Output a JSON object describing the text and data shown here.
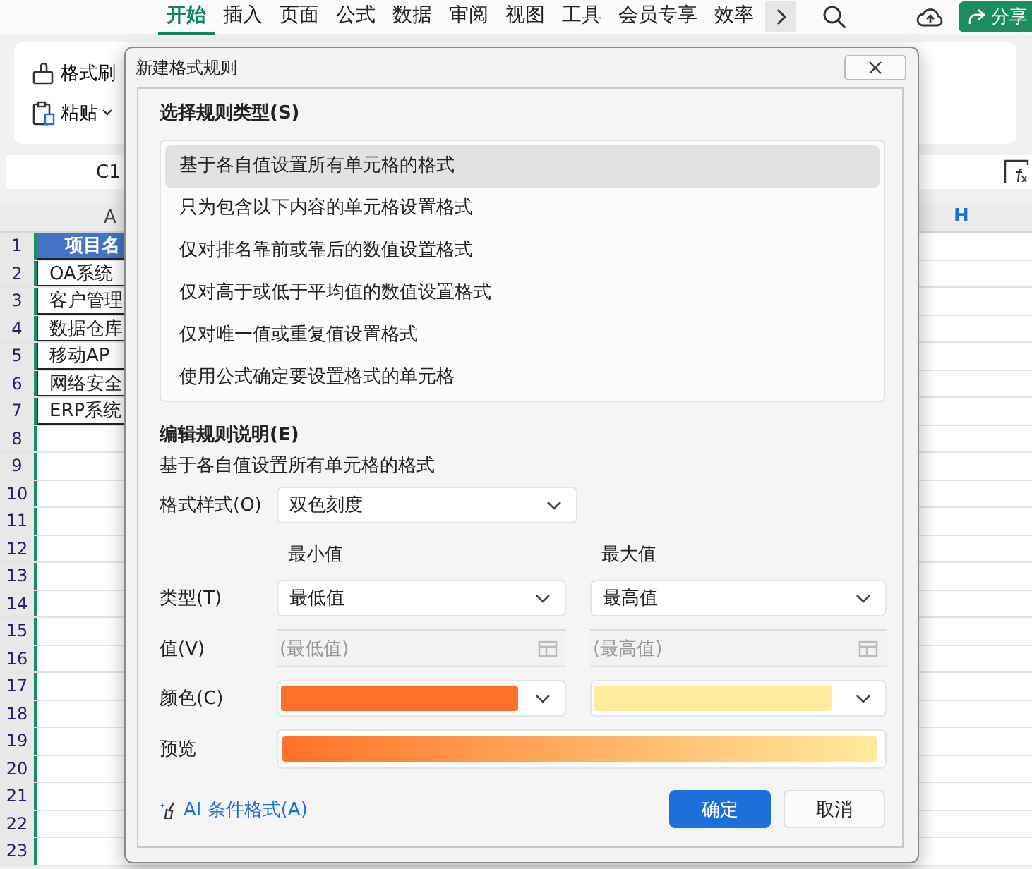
{
  "menu_tabs": [
    {
      "label": "开始",
      "selected": true
    },
    {
      "label": "插入",
      "selected": false
    },
    {
      "label": "页面",
      "selected": false
    },
    {
      "label": "公式",
      "selected": false
    },
    {
      "label": "数据",
      "selected": false
    },
    {
      "label": "审阅",
      "selected": false
    },
    {
      "label": "视图",
      "selected": false
    },
    {
      "label": "工具",
      "selected": false
    },
    {
      "label": "会员专享",
      "selected": false
    },
    {
      "label": "效率",
      "selected": false
    }
  ],
  "share_button": "分享",
  "ribbon": {
    "format_painter": "格式刷",
    "paste": "粘贴"
  },
  "name_box": "C1",
  "columns": [
    "A",
    "H"
  ],
  "rows": [
    {
      "number": "1",
      "kind": "header",
      "a": "项目名"
    },
    {
      "number": "2",
      "kind": "data",
      "a": "OA系统"
    },
    {
      "number": "3",
      "kind": "data",
      "a": "客户管理"
    },
    {
      "number": "4",
      "kind": "data",
      "a": "数据仓库"
    },
    {
      "number": "5",
      "kind": "data",
      "a": "移动AP"
    },
    {
      "number": "6",
      "kind": "data",
      "a": "网络安全"
    },
    {
      "number": "7",
      "kind": "data",
      "a": "ERP系统"
    },
    {
      "number": "8",
      "kind": "empty"
    },
    {
      "number": "9",
      "kind": "empty"
    },
    {
      "number": "10",
      "kind": "empty"
    },
    {
      "number": "11",
      "kind": "empty"
    },
    {
      "number": "12",
      "kind": "empty"
    },
    {
      "number": "13",
      "kind": "empty"
    },
    {
      "number": "14",
      "kind": "empty"
    },
    {
      "number": "15",
      "kind": "empty"
    },
    {
      "number": "16",
      "kind": "empty"
    },
    {
      "number": "17",
      "kind": "empty"
    },
    {
      "number": "18",
      "kind": "empty"
    },
    {
      "number": "19",
      "kind": "empty"
    },
    {
      "number": "20",
      "kind": "empty"
    },
    {
      "number": "21",
      "kind": "empty"
    },
    {
      "number": "22",
      "kind": "empty"
    },
    {
      "number": "23",
      "kind": "empty"
    }
  ],
  "dialog": {
    "title": "新建格式规则",
    "rule_type_heading": "选择规则类型(S)",
    "rule_types": [
      {
        "label": "基于各自值设置所有单元格的格式",
        "selected": true
      },
      {
        "label": "只为包含以下内容的单元格设置格式",
        "selected": false
      },
      {
        "label": "仅对排名靠前或靠后的数值设置格式",
        "selected": false
      },
      {
        "label": "仅对高于或低于平均值的数值设置格式",
        "selected": false
      },
      {
        "label": "仅对唯一值或重复值设置格式",
        "selected": false
      },
      {
        "label": "使用公式确定要设置格式的单元格",
        "selected": false
      }
    ],
    "edit_heading": "编辑规则说明(E)",
    "description": "基于各自值设置所有单元格的格式",
    "format_style_label": "格式样式(O)",
    "format_style": "双色刻度",
    "type_label": "类型(T)",
    "value_label": "值(V)",
    "color_label": "颜色(C)",
    "preview_label": "预览",
    "scale": [
      {
        "heading": "最小值",
        "type": "最低值",
        "value": "(最低值)",
        "value_disabled": true,
        "color": "#ff7128"
      },
      {
        "heading": "最大值",
        "type": "最高值",
        "value": "(最高值)",
        "value_disabled": true,
        "color": "#ffeb9c"
      }
    ],
    "ai_link": "AI 条件格式(A)",
    "buttons": [
      {
        "label": "确定",
        "kind": "primary"
      },
      {
        "label": "取消",
        "kind": "secondary"
      }
    ]
  }
}
